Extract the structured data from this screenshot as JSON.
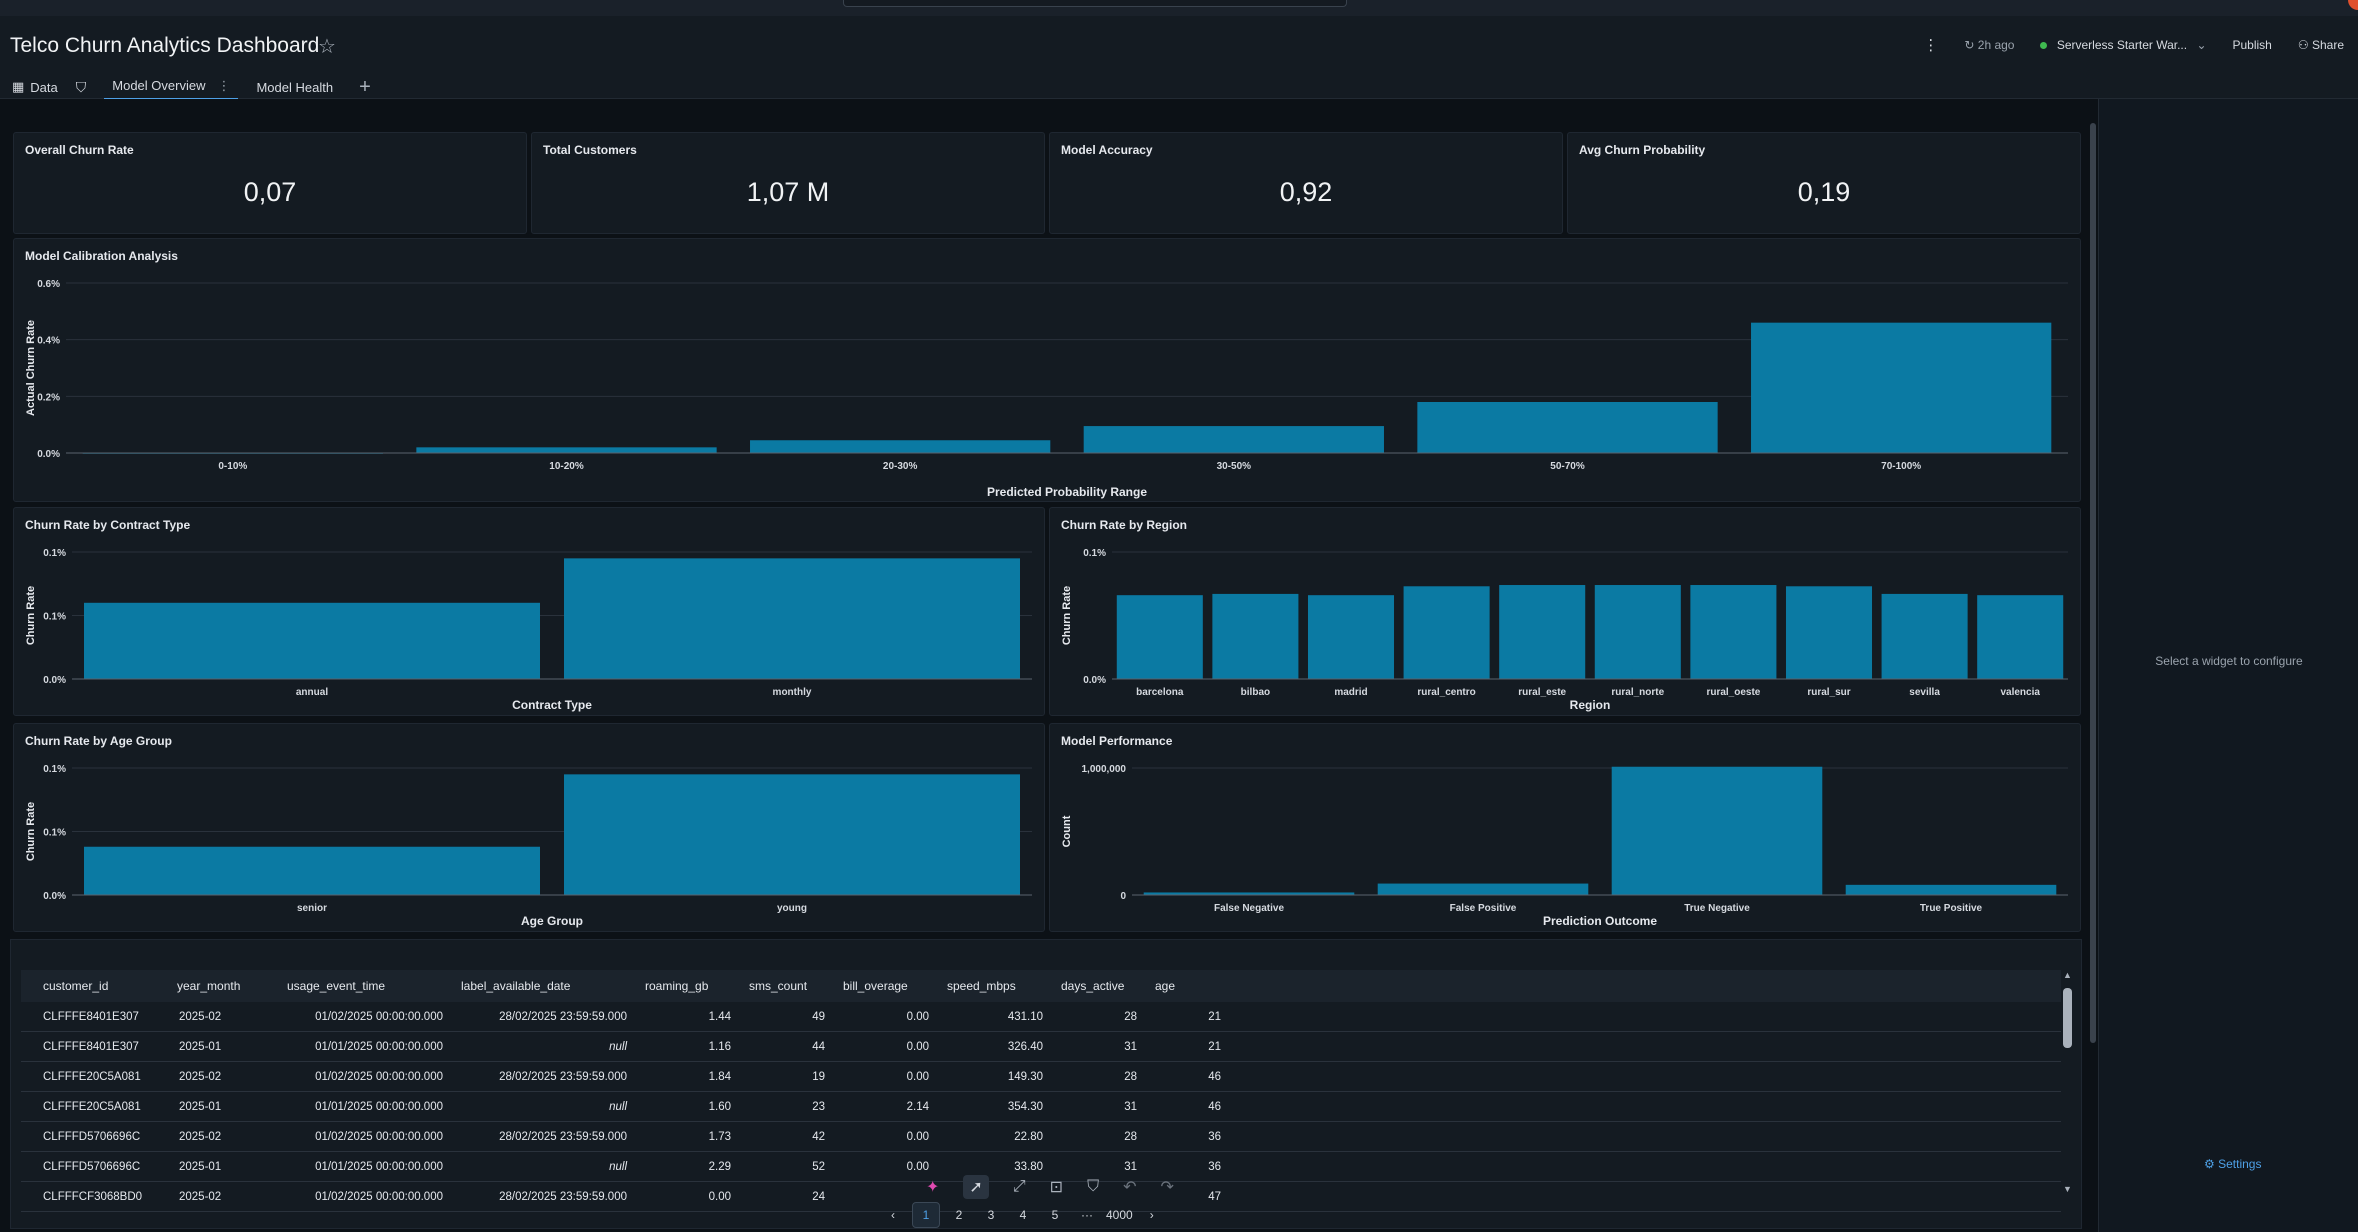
{
  "app": {
    "title": "Telco Churn Analytics Dashboard",
    "updated": "2h ago",
    "warehouse": "Serverless Starter War...",
    "publish": "Publish",
    "share": "Share"
  },
  "tabs": [
    {
      "label": "Data",
      "icon": "table-icon"
    },
    {
      "label": "Model Overview",
      "icon": "",
      "active": true
    },
    {
      "label": "Model Health",
      "icon": ""
    }
  ],
  "kpis": [
    {
      "title": "Overall Churn Rate",
      "value": "0,07"
    },
    {
      "title": "Total Customers",
      "value": "1,07 M"
    },
    {
      "title": "Model Accuracy",
      "value": "0,92"
    },
    {
      "title": "Avg Churn Probability",
      "value": "0,19"
    }
  ],
  "chart_data": [
    {
      "type": "bar",
      "title": "Model Calibration Analysis",
      "xlabel": "Predicted Probability Range",
      "ylabel": "Actual Churn Rate",
      "categories": [
        "0-10%",
        "10-20%",
        "20-30%",
        "30-50%",
        "50-70%",
        "70-100%"
      ],
      "values": [
        0.001,
        0.02,
        0.045,
        0.095,
        0.18,
        0.46
      ],
      "yticks": [
        "0.0%",
        "0.2%",
        "0.4%",
        "0.6%"
      ],
      "ylim": [
        0,
        0.6
      ]
    },
    {
      "type": "bar",
      "title": "Churn Rate by Contract Type",
      "xlabel": "Contract Type",
      "ylabel": "Churn Rate",
      "categories": [
        "annual",
        "monthly"
      ],
      "values": [
        0.06,
        0.095
      ],
      "yticks": [
        "0.0%",
        "0.1%",
        "0.1%"
      ],
      "ylim": [
        0,
        0.1
      ]
    },
    {
      "type": "bar",
      "title": "Churn Rate by Region",
      "xlabel": "Region",
      "ylabel": "Churn Rate",
      "categories": [
        "barcelona",
        "bilbao",
        "madrid",
        "rural_centro",
        "rural_este",
        "rural_norte",
        "rural_oeste",
        "rural_sur",
        "sevilla",
        "valencia"
      ],
      "values": [
        0.066,
        0.067,
        0.066,
        0.073,
        0.074,
        0.074,
        0.074,
        0.073,
        0.067,
        0.066
      ],
      "yticks": [
        "0.0%",
        "0.1%"
      ],
      "ylim": [
        0,
        0.1
      ]
    },
    {
      "type": "bar",
      "title": "Churn Rate by Age Group",
      "xlabel": "Age Group",
      "ylabel": "Churn Rate",
      "categories": [
        "senior",
        "young"
      ],
      "values": [
        0.038,
        0.095
      ],
      "yticks": [
        "0.0%",
        "0.1%",
        "0.1%"
      ],
      "ylim": [
        0,
        0.1
      ]
    },
    {
      "type": "bar",
      "title": "Model Performance",
      "xlabel": "Prediction Outcome",
      "ylabel": "Count",
      "categories": [
        "False Negative",
        "False Positive",
        "True Negative",
        "True Positive"
      ],
      "values": [
        20000,
        90000,
        1010000,
        80000
      ],
      "yticks": [
        "0",
        "1,000,000"
      ],
      "ylim": [
        0,
        1000000
      ]
    }
  ],
  "table": {
    "columns": [
      "customer_id",
      "year_month",
      "usage_event_time",
      "label_available_date",
      "roaming_gb",
      "sms_count",
      "bill_overage",
      "speed_mbps",
      "days_active",
      "age"
    ],
    "rows": [
      [
        "CLFFFE8401E307",
        "2025-02",
        "01/02/2025 00:00:00.000",
        "28/02/2025 23:59:59.000",
        "1.44",
        "49",
        "0.00",
        "431.10",
        "28",
        "21"
      ],
      [
        "CLFFFE8401E307",
        "2025-01",
        "01/01/2025 00:00:00.000",
        "null",
        "1.16",
        "44",
        "0.00",
        "326.40",
        "31",
        "21"
      ],
      [
        "CLFFFE20C5A081",
        "2025-02",
        "01/02/2025 00:00:00.000",
        "28/02/2025 23:59:59.000",
        "1.84",
        "19",
        "0.00",
        "149.30",
        "28",
        "46"
      ],
      [
        "CLFFFE20C5A081",
        "2025-01",
        "01/01/2025 00:00:00.000",
        "null",
        "1.60",
        "23",
        "2.14",
        "354.30",
        "31",
        "46"
      ],
      [
        "CLFFFD5706696C",
        "2025-02",
        "01/02/2025 00:00:00.000",
        "28/02/2025 23:59:59.000",
        "1.73",
        "42",
        "0.00",
        "22.80",
        "28",
        "36"
      ],
      [
        "CLFFFD5706696C",
        "2025-01",
        "01/01/2025 00:00:00.000",
        "null",
        "2.29",
        "52",
        "0.00",
        "33.80",
        "31",
        "36"
      ],
      [
        "CLFFFCF3068BD0",
        "2025-02",
        "01/02/2025 00:00:00.000",
        "28/02/2025 23:59:59.000",
        "0.00",
        "24",
        "",
        "",
        "",
        "47"
      ]
    ]
  },
  "pager": {
    "pages": [
      "1",
      "2",
      "3",
      "4",
      "5"
    ],
    "ellipsis": "···",
    "last": "4000"
  },
  "right_panel": {
    "message": "Select a widget to configure",
    "settings": "Settings"
  },
  "colors": {
    "bar": "#0b7aa3",
    "accent": "#4ea0e6",
    "background": "#0c1116"
  }
}
